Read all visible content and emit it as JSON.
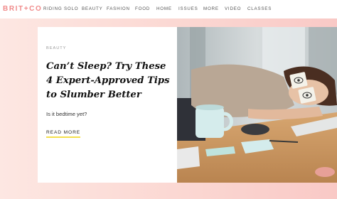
{
  "brand": {
    "logo_text": "BRIT+CO"
  },
  "nav": {
    "items": [
      {
        "label": "RIDING SOLO"
      },
      {
        "label": "BEAUTY"
      },
      {
        "label": "FASHION"
      },
      {
        "label": "FOOD"
      },
      {
        "label": "HOME"
      },
      {
        "label": "ISSUES"
      },
      {
        "label": "MORE"
      },
      {
        "label": "VIDEO"
      },
      {
        "label": "CLASSES"
      }
    ]
  },
  "hero": {
    "category": "BEAUTY",
    "title": "Can’t Sleep? Try These 4 Expert-Approved Tips to Slumber Better",
    "subtitle": "Is it bedtime yet?",
    "cta": "READ MORE"
  },
  "colors": {
    "logo": "#f08a8a",
    "hero_background": "#fbd7d2",
    "cta_underline": "#f4e04d"
  },
  "photo": {
    "icon": "woman-sleeping-at-desk-photo"
  }
}
